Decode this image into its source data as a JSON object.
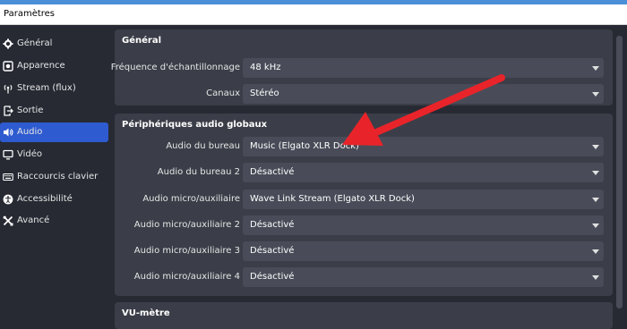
{
  "window": {
    "title": "Paramètres"
  },
  "sidebar": {
    "items": [
      {
        "label": "Général",
        "icon": "gear-icon"
      },
      {
        "label": "Apparence",
        "icon": "palette-icon"
      },
      {
        "label": "Stream (flux)",
        "icon": "broadcast-icon"
      },
      {
        "label": "Sortie",
        "icon": "output-icon"
      },
      {
        "label": "Audio",
        "icon": "speaker-icon",
        "active": true
      },
      {
        "label": "Vidéo",
        "icon": "monitor-icon"
      },
      {
        "label": "Raccourcis clavier",
        "icon": "keyboard-icon"
      },
      {
        "label": "Accessibilité",
        "icon": "accessibility-icon"
      },
      {
        "label": "Avancé",
        "icon": "tools-icon"
      }
    ]
  },
  "general": {
    "title": "Général",
    "sample_rate_label": "Fréquence d'échantillonnage",
    "sample_rate_value": "48 kHz",
    "channels_label": "Canaux",
    "channels_value": "Stéréo"
  },
  "global_devices": {
    "title": "Périphériques audio globaux",
    "rows": [
      {
        "label": "Audio du bureau",
        "value": "Music (Elgato XLR Dock)"
      },
      {
        "label": "Audio du bureau 2",
        "value": "Désactivé"
      },
      {
        "label": "Audio micro/auxiliaire",
        "value": "Wave Link Stream (Elgato XLR Dock)"
      },
      {
        "label": "Audio micro/auxiliaire 2",
        "value": "Désactivé"
      },
      {
        "label": "Audio micro/auxiliaire 3",
        "value": "Désactivé"
      },
      {
        "label": "Audio micro/auxiliaire 4",
        "value": "Désactivé"
      }
    ]
  },
  "vu_meter": {
    "title": "VU-mètre"
  },
  "colors": {
    "accent": "#2f5bd0",
    "annotation_arrow": "#e8242a"
  }
}
